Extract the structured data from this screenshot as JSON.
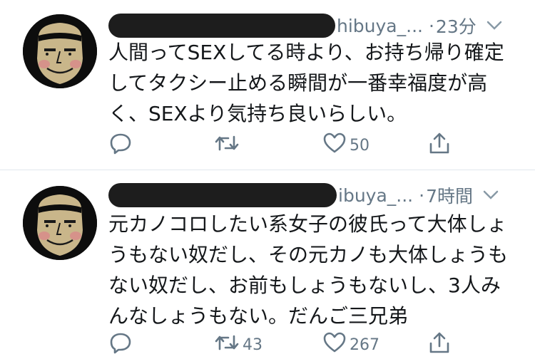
{
  "tweets": [
    {
      "handle_suffix": "hibuya_...",
      "separator": "·",
      "time": "23分",
      "text_lines": [
        "人間ってSEXしてる時より、お持ち帰り確定",
        "してタクシー止める瞬間が一番幸福度が高",
        "く、SEXより気持ち良いらしい。"
      ],
      "reply_count": "",
      "retweet_count": "",
      "like_count": "50"
    },
    {
      "handle_suffix": "ibuya_...",
      "separator": "·",
      "time": "7時間",
      "text_lines": [
        "元カノコロしたい系女子の彼氏って大体しょ",
        "うもない奴だし、その元カノも大体しょうも",
        "ない奴だし、お前もしょうもないし、3人み",
        "んなしょうもない。だんご三兄弟"
      ],
      "reply_count": "",
      "retweet_count": "43",
      "like_count": "267"
    }
  ],
  "icons": {
    "reply": "reply-icon",
    "retweet": "retweet-icon",
    "like": "heart-icon",
    "share": "share-icon",
    "menu": "chevron-down-icon"
  },
  "colors": {
    "text": "#14171a",
    "secondary": "#657786",
    "divider": "#e1e8ed",
    "redaction": "#1d1d1d"
  }
}
